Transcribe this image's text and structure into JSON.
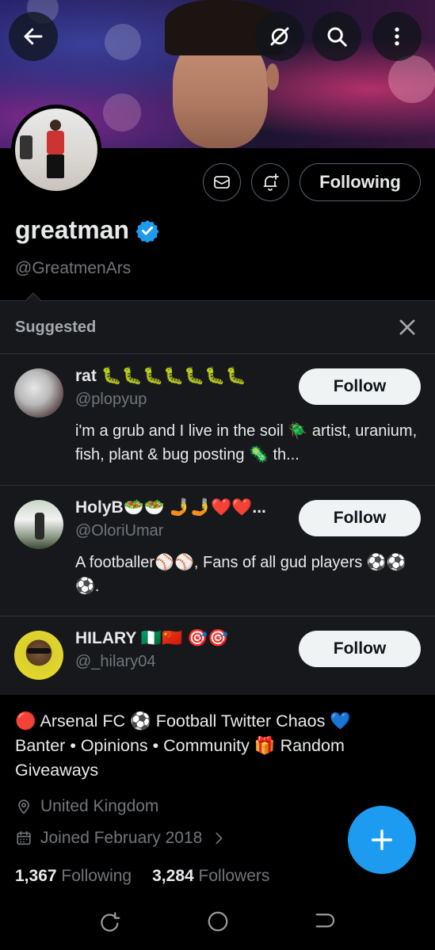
{
  "header": {
    "back_icon": "arrow-left-icon",
    "grok_icon": "grok-icon",
    "search_icon": "search-icon",
    "more_icon": "more-vertical-icon"
  },
  "profile": {
    "display_name": "greatman",
    "handle": "@GreatmenArs",
    "following_label": "Following",
    "verified_color": "#1d9bf0",
    "bio_line1": "🔴 Arsenal FC  ⚽ Football Twitter Chaos  💙",
    "bio_line2": "Banter • Opinions • Community  🎁 Random",
    "bio_line3": "Giveaways",
    "location": "United Kingdom",
    "joined": "Joined February 2018",
    "following_count": "1,367",
    "following_text": "Following",
    "followers_count": "3,284",
    "followers_text": "Followers"
  },
  "suggested": {
    "title": "Suggested",
    "items": [
      {
        "name": "rat 🐛🐛🐛🐛🐛🐛🐛",
        "handle": "@plopyup",
        "bio": "i'm a grub and I live in the soil 🪲 artist, uranium, fish, plant & bug posting 🦠 th...",
        "button": "Follow"
      },
      {
        "name": "HolyB🥗🥗 🤳🤳❤️❤️...",
        "handle": "@OloriUmar",
        "bio": "A footballer⚾⚾, Fans of all gud players ⚽⚽⚽.",
        "button": "Follow"
      },
      {
        "name": "HILARY 🇳🇬🇨🇳 🎯🎯",
        "handle": "@_hilary04",
        "bio": "",
        "button": "Follow"
      }
    ]
  },
  "colors": {
    "accent": "#1d9bf0",
    "background": "#000000",
    "suggested_bg": "#16181c",
    "muted_text": "#71767b"
  }
}
